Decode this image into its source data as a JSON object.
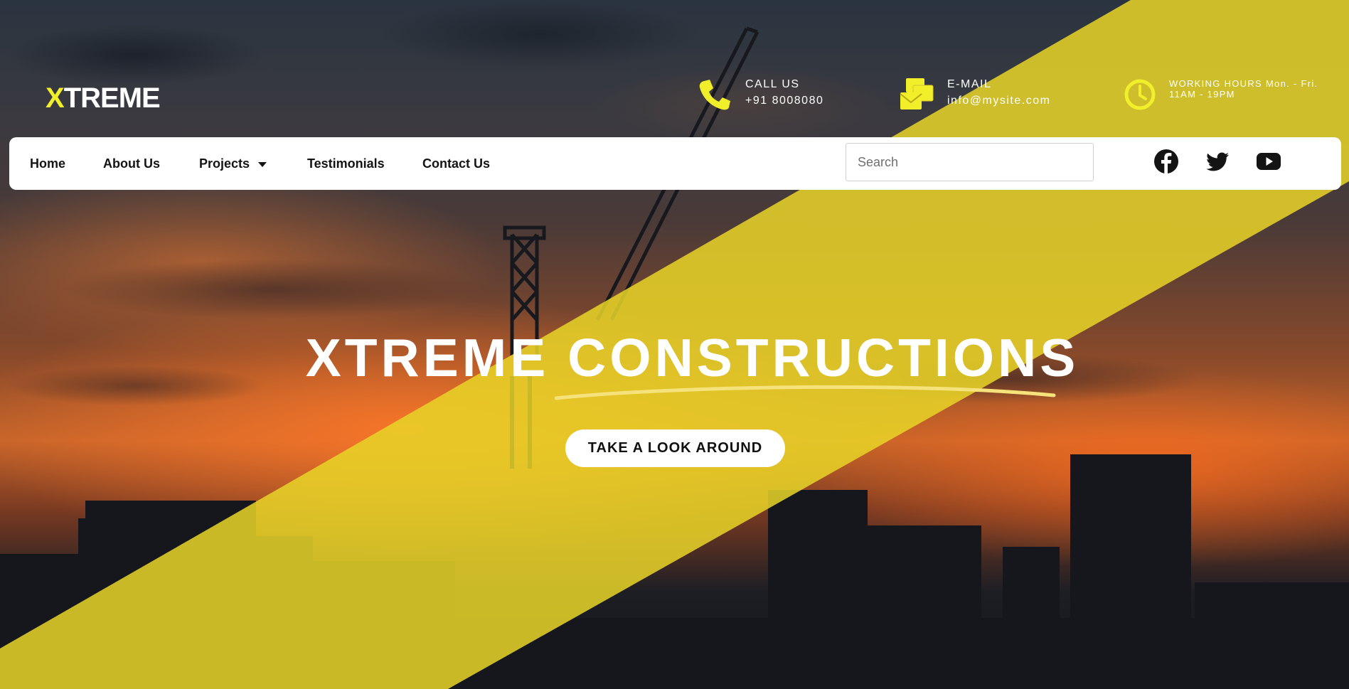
{
  "brand": {
    "logo_text": "XTREME"
  },
  "header": {
    "call": {
      "label": "CALL US",
      "value": "+91 8008080",
      "icon": "phone-icon"
    },
    "email": {
      "label": "E-MAIL",
      "value": "info@mysite.com",
      "icon": "envelope-icon"
    },
    "hours": {
      "text": "WORKING HOURS Mon. - Fri. 11AM - 19PM",
      "icon": "clock-icon"
    }
  },
  "nav": {
    "items": [
      {
        "label": "Home"
      },
      {
        "label": "About Us"
      },
      {
        "label": "Projects",
        "has_dropdown": true
      },
      {
        "label": "Testimonials"
      },
      {
        "label": "Contact Us"
      }
    ],
    "search_placeholder": "Search",
    "social": [
      "facebook-icon",
      "twitter-icon",
      "youtube-icon"
    ]
  },
  "hero": {
    "title_part1": "XTREME ",
    "title_part2": "CONSTRUCTIONS",
    "cta_label": "TAKE A LOOK AROUND"
  },
  "colors": {
    "accent_yellow": "#f0ef2a",
    "band_yellow": "#e8d428",
    "white": "#ffffff",
    "nav_text": "#141414"
  }
}
